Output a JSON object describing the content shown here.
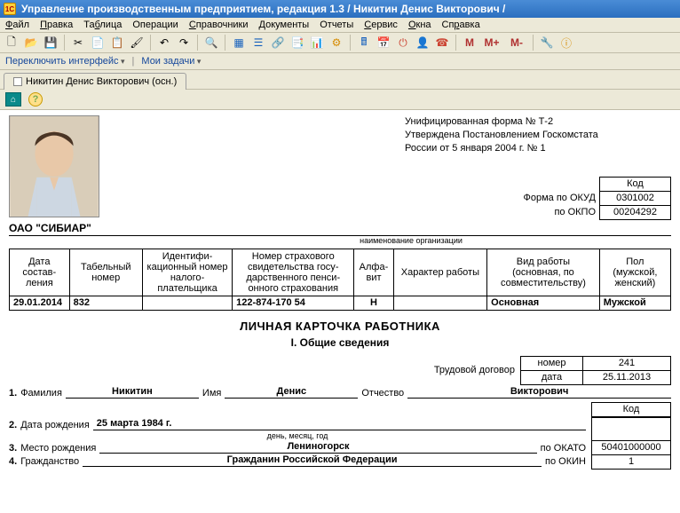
{
  "window": {
    "title": "Управление производственным предприятием, редакция 1.3 / Никитин Денис Викторович /"
  },
  "menu": {
    "file": "Файл",
    "edit": "Правка",
    "table": "Таблица",
    "ops": "Операции",
    "refs": "Справочники",
    "docs": "Документы",
    "reports": "Отчеты",
    "service": "Сервис",
    "windows": "Окна",
    "help": "Справка"
  },
  "switchbar": {
    "switch": "Переключить интерфейс",
    "tasks": "Мои задачи"
  },
  "tab": {
    "label": "Никитин Денис Викторович (осн.)"
  },
  "stamp": {
    "l1": "Унифицированная форма № Т-2",
    "l2": "Утверждена Постановлением Госкомстата",
    "l3": "России от 5 января 2004 г. № 1"
  },
  "codes": {
    "code_hdr": "Код",
    "okud_lbl": "Форма по ОКУД",
    "okud": "0301002",
    "okpo_lbl": "по ОКПО",
    "okpo": "00204292"
  },
  "org": {
    "name": "ОАО \"СИБИАР\"",
    "cap": "наименование организации"
  },
  "grid": {
    "h1": "Дата состав­ления",
    "h2": "Табельный номер",
    "h3": "Идентифи­кационный номер налого­плательщика",
    "h4": "Номер страхового свидетельства госу­дарственного пенси­онного страхования",
    "h5": "Алфа­вит",
    "h6": "Характер работы",
    "h7": "Вид работы (основная, по совместительству)",
    "h8": "Пол (мужской, женский)",
    "v1": "29.01.2014",
    "v2": "832",
    "v3": "",
    "v4": "122-874-170 54",
    "v5": "Н",
    "v6": "",
    "v7": "Основная",
    "v8": "Мужской"
  },
  "title": "ЛИЧНАЯ КАРТОЧКА РАБОТНИКА",
  "section": "I. Общие сведения",
  "contract": {
    "lbl": "Трудовой договор",
    "num_lbl": "номер",
    "num": "241",
    "date_lbl": "дата",
    "date": "25.11.2013"
  },
  "fields": {
    "f1_num": "1.",
    "f1_lbl": "Фамилия",
    "f1_val": "Никитин",
    "f1b_lbl": "Имя",
    "f1b_val": "Денис",
    "f1c_lbl": "Отчество",
    "f1c_val": "Викторович",
    "f2_num": "2.",
    "f2_lbl": "Дата рождения",
    "f2_val": "25 марта 1984 г.",
    "f2_cap": "день, месяц, год",
    "f3_num": "3.",
    "f3_lbl": "Место рождения",
    "f3_val": "Лениногорск",
    "f3_code_lbl": "по ОКАТО",
    "f3_code": "50401000000",
    "f4_num": "4.",
    "f4_lbl": "Гражданство",
    "f4_val": "Гражданин Российской Федерации",
    "f4_code_lbl": "по ОКИН",
    "f4_code": "1",
    "code_hdr": "Код"
  },
  "toolbar_fmt": {
    "M": "М",
    "Mp": "М+",
    "Mm": "М-"
  }
}
